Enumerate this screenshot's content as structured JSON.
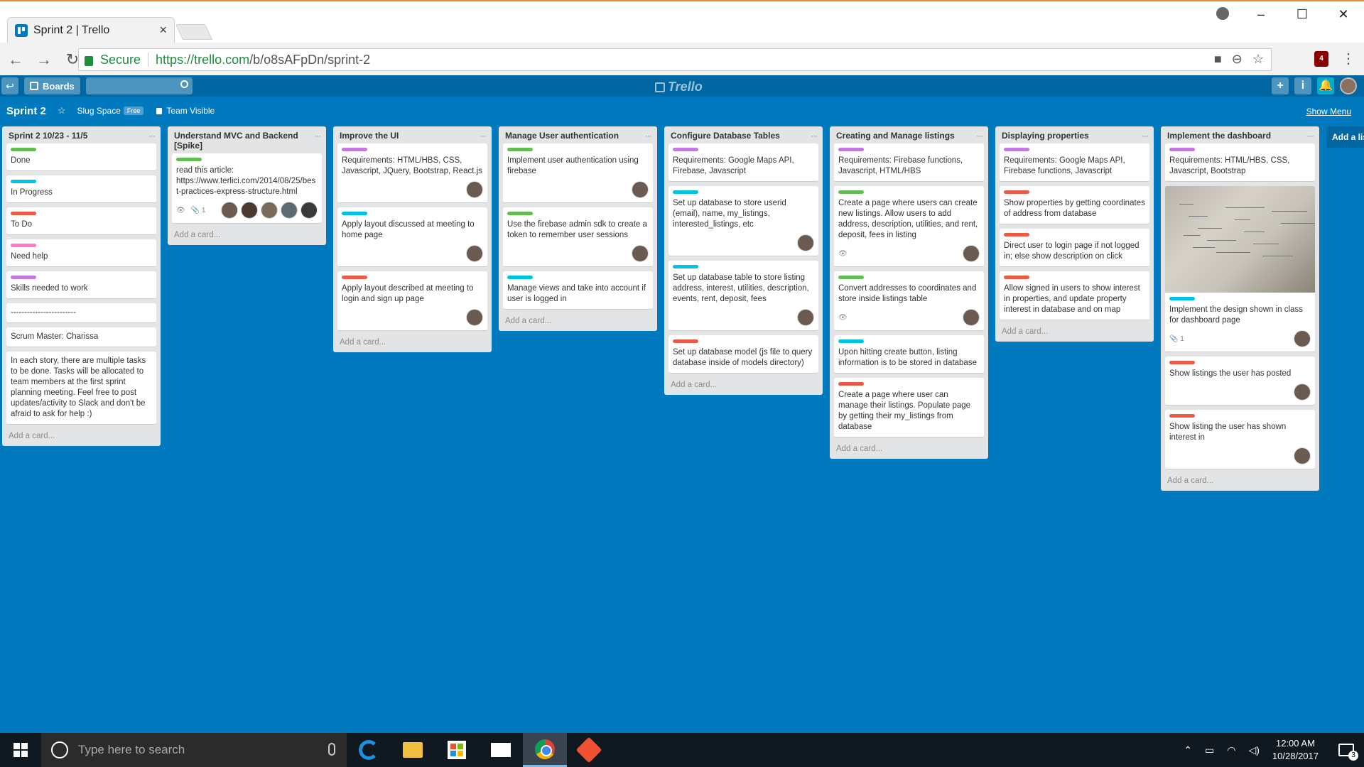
{
  "browser": {
    "tab_title": "Sprint 2 | Trello",
    "tab_close": "×",
    "secure_label": "Secure",
    "url_host": "https://trello.com",
    "url_path": "/b/o8sAFpDn/sprint-2",
    "ublock_count": "4"
  },
  "trello": {
    "boards_label": "Boards",
    "logo_text": "Trello",
    "add_btn": "+",
    "info_btn": "i",
    "notify_btn": "🔔"
  },
  "board": {
    "title": "Sprint 2",
    "team": "Slug Space",
    "team_badge": "Free",
    "visibility": "Team Visible",
    "show_menu": "Show Menu",
    "add_list": "Add a list..."
  },
  "colors": {
    "green": "#61bd4f",
    "blue": "#00c2e0",
    "red": "#eb5a46",
    "pink": "#ff78cb",
    "purple": "#c377e0"
  },
  "lists": [
    {
      "title": "Sprint 2 10/23 - 11/5",
      "add_card": "Add a card...",
      "cards": [
        {
          "label": "green",
          "text": "Done"
        },
        {
          "label": "blue",
          "text": "In Progress"
        },
        {
          "label": "red",
          "text": "To Do"
        },
        {
          "label": "pink",
          "text": "Need help"
        },
        {
          "label": "purple",
          "text": "Skills needed to work"
        },
        {
          "text": "------------------------"
        },
        {
          "text": "Scrum Master: Charissa"
        },
        {
          "text": "In each story, there are multiple tasks to be done. Tasks will be allocated to team members at the first sprint planning meeting. Feel free to post updates/activity to Slack and don't be afraid to ask for help :)"
        }
      ]
    },
    {
      "title": "Understand MVC and Backend [Spike]",
      "add_card": "Add a card...",
      "cards": [
        {
          "label": "green",
          "text": "read this article: https://www.terlici.com/2014/08/25/best-practices-express-structure.html",
          "badges": [
            "👁",
            "📎 1"
          ],
          "members": 5
        }
      ]
    },
    {
      "title": "Improve the UI",
      "add_card": "Add a card...",
      "cards": [
        {
          "label": "purple",
          "text": "Requirements: HTML/HBS, CSS, Javascript, JQuery, Bootstrap, React.js",
          "members": 1
        },
        {
          "label": "blue",
          "text": "Apply layout discussed at meeting to home page",
          "members": 1
        },
        {
          "label": "red",
          "text": "Apply layout described at meeting to login and sign up page",
          "members": 1
        }
      ]
    },
    {
      "title": "Manage User authentication",
      "add_card": "Add a card...",
      "cards": [
        {
          "label": "green",
          "text": "Implement user authentication using firebase",
          "members": 1
        },
        {
          "label": "green",
          "text": "Use the firebase admin sdk to create a token to remember user sessions",
          "members": 1
        },
        {
          "label": "blue",
          "text": "Manage views and take into account if user is logged in"
        }
      ]
    },
    {
      "title": "Configure Database Tables",
      "add_card": "Add a card...",
      "cards": [
        {
          "label": "purple",
          "text": "Requirements: Google Maps API, Firebase, Javascript"
        },
        {
          "label": "blue",
          "text": "Set up database to store userid (email), name, my_listings, interested_listings, etc",
          "members": 1
        },
        {
          "label": "blue",
          "text": "Set up database table to store listing address, interest, utilities, description, events, rent, deposit, fees",
          "members": 1
        },
        {
          "label": "red",
          "text": "Set up database model (js file to query database inside of models directory)"
        }
      ]
    },
    {
      "title": "Creating and Manage listings",
      "add_card": "Add a card...",
      "cards": [
        {
          "label": "purple",
          "text": "Requirements: Firebase functions, Javascript, HTML/HBS"
        },
        {
          "label": "green",
          "text": "Create a page where users can create new listings. Allow users to add address, description, utilities, and rent, deposit, fees in listing",
          "badges": [
            "👁"
          ],
          "members": 1
        },
        {
          "label": "green",
          "text": "Convert addresses to coordinates and store inside listings table",
          "badges": [
            "👁"
          ],
          "members": 1
        },
        {
          "label": "blue",
          "text": "Upon hitting create button, listing information is to be stored in database"
        },
        {
          "label": "red",
          "text": "Create a page where user can manage their listings. Populate page by getting their my_listings from database"
        }
      ]
    },
    {
      "title": "Displaying properties",
      "add_card": "Add a card...",
      "cards": [
        {
          "label": "purple",
          "text": "Requirements: Google Maps API, Firebase functions, Javascript"
        },
        {
          "label": "red",
          "text": "Show properties by getting coordinates of address from database"
        },
        {
          "label": "red",
          "text": "Direct user to login page if not logged in; else show description on click"
        },
        {
          "label": "red",
          "text": "Allow signed in users to show interest in properties, and update property interest in database and on map"
        }
      ]
    },
    {
      "title": "Implement the dashboard",
      "add_card": "Add a card...",
      "cards": [
        {
          "label": "purple",
          "text": "Requirements: HTML/HBS, CSS, Javascript, Bootstrap"
        },
        {
          "image": true,
          "label": "blue",
          "text": "Implement the design shown in class for dashboard page",
          "badges": [
            "📎 1"
          ],
          "members": 1
        },
        {
          "label": "red",
          "text": "Show listings the user has posted",
          "members": 1
        },
        {
          "label": "red",
          "text": "Show listing the user has shown interest in",
          "members": 1
        }
      ]
    }
  ],
  "taskbar": {
    "search_placeholder": "Type here to search",
    "time": "12:00 AM",
    "date": "10/28/2017",
    "notif_count": "3"
  }
}
